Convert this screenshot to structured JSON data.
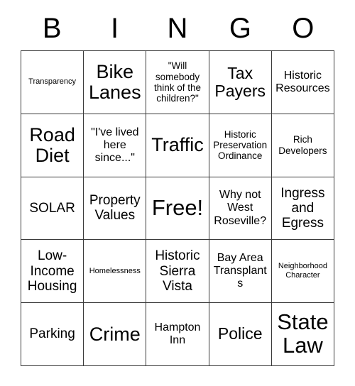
{
  "card": {
    "header_letters": [
      "B",
      "I",
      "N",
      "G",
      "O"
    ],
    "rows": [
      [
        {
          "text": "Transparency",
          "size": "fs-xs"
        },
        {
          "text": "Bike\nLanes",
          "size": "fs-xxl"
        },
        {
          "text": "\"Will\nsomebody\nthink of the\nchildren?\"",
          "size": "fs-sm"
        },
        {
          "text": "Tax\nPayers",
          "size": "fs-xl"
        },
        {
          "text": "Historic\nResources",
          "size": "fs-md"
        }
      ],
      [
        {
          "text": "Road\nDiet",
          "size": "fs-xxl"
        },
        {
          "text": "\"I've lived\nhere\nsince...\"",
          "size": "fs-md"
        },
        {
          "text": "Traffic",
          "size": "fs-xxl"
        },
        {
          "text": "Historic\nPreservation\nOrdinance",
          "size": "fs-sm"
        },
        {
          "text": "Rich\nDevelopers",
          "size": "fs-sm"
        }
      ],
      [
        {
          "text": "SOLAR",
          "size": "fs-lg"
        },
        {
          "text": "Property\nValues",
          "size": "fs-lg"
        },
        {
          "text": "Free!",
          "size": "fs-huge"
        },
        {
          "text": "Why not\nWest\nRoseville?",
          "size": "fs-md"
        },
        {
          "text": "Ingress\nand\nEgress",
          "size": "fs-lg"
        }
      ],
      [
        {
          "text": "Low-\nIncome\nHousing",
          "size": "fs-lg"
        },
        {
          "text": "Homelessness",
          "size": "fs-xs"
        },
        {
          "text": "Historic\nSierra\nVista",
          "size": "fs-lg"
        },
        {
          "text": "Bay Area\nTransplants",
          "size": "fs-md"
        },
        {
          "text": "Neighborhood\nCharacter",
          "size": "fs-xs"
        }
      ],
      [
        {
          "text": "Parking",
          "size": "fs-lg"
        },
        {
          "text": "Crime",
          "size": "fs-xxl"
        },
        {
          "text": "Hampton\nInn",
          "size": "fs-md"
        },
        {
          "text": "Police",
          "size": "fs-xl"
        },
        {
          "text": "State\nLaw",
          "size": "fs-huge"
        }
      ]
    ]
  }
}
